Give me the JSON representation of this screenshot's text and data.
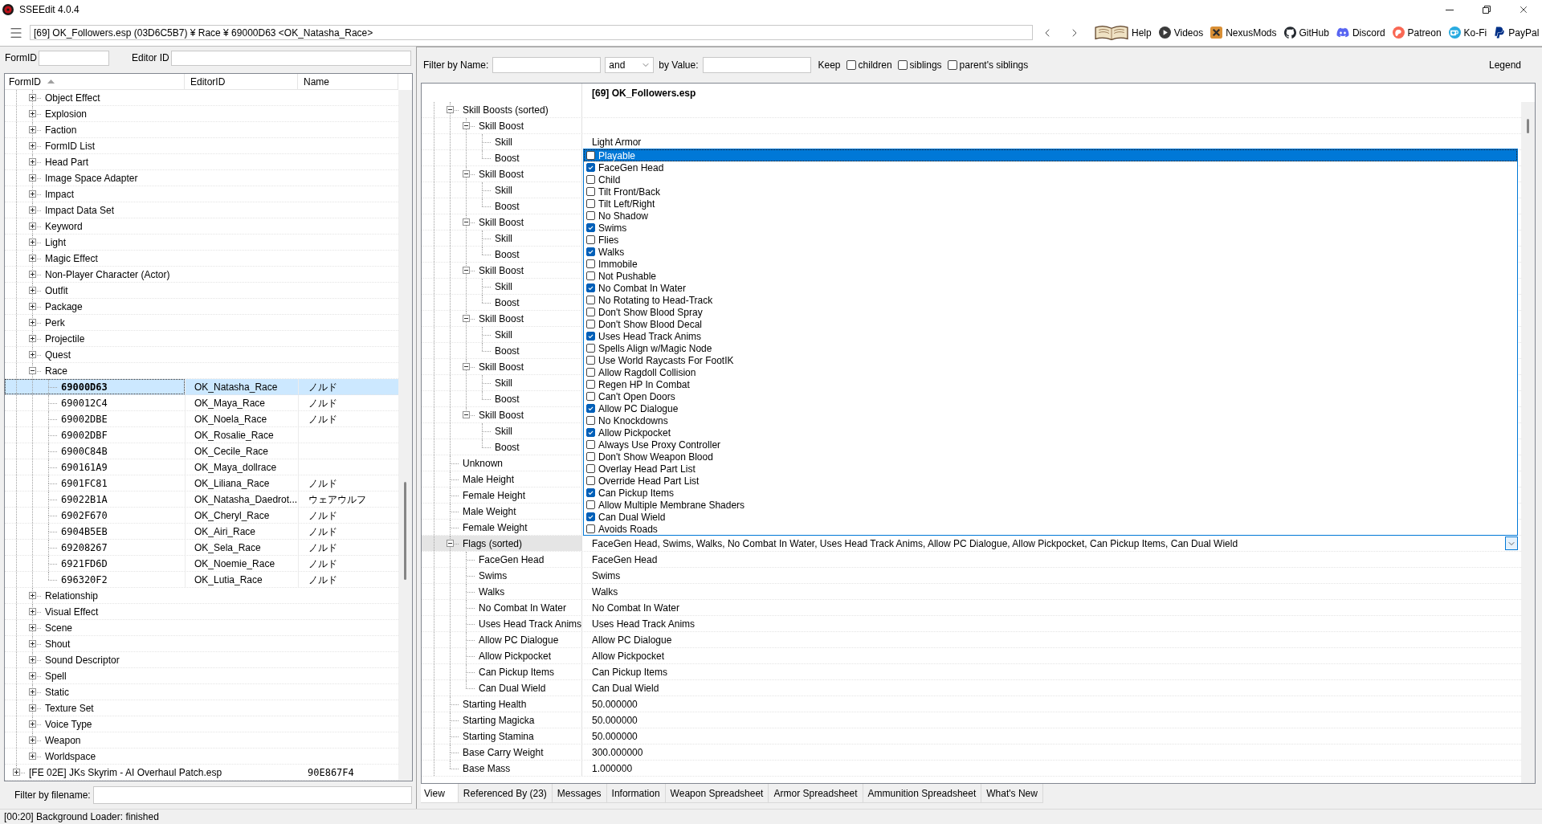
{
  "window": {
    "title": "SSEEdit 4.0.4"
  },
  "address_bar": {
    "path": "[69] OK_Followers.esp (03D6C5B7) ¥ Race ¥ 69000D63 <OK_Natasha_Race>"
  },
  "links": [
    {
      "label": "Help",
      "kind": "book"
    },
    {
      "label": "Videos",
      "kind": "videos"
    },
    {
      "label": "NexusMods",
      "kind": "nexus"
    },
    {
      "label": "GitHub",
      "kind": "github"
    },
    {
      "label": "Discord",
      "kind": "discord"
    },
    {
      "label": "Patreon",
      "kind": "patreon"
    },
    {
      "label": "Ko-Fi",
      "kind": "kofi"
    },
    {
      "label": "PayPal",
      "kind": "paypal"
    }
  ],
  "nav_filters": [
    {
      "label": "FormID"
    },
    {
      "label": "Editor ID"
    }
  ],
  "nav_tree": {
    "columns": [
      {
        "label": "FormID",
        "sorted": true
      },
      {
        "label": "EditorID",
        "sorted": false
      },
      {
        "label": "Name",
        "sorted": false
      }
    ],
    "nodes": [
      {
        "children": [
          {
            "label": "Object Effect",
            "expanded": false,
            "selected": false
          },
          {
            "label": "Explosion",
            "expanded": false,
            "selected": false
          },
          {
            "label": "Faction",
            "expanded": false,
            "selected": false
          },
          {
            "label": "FormID List",
            "expanded": false,
            "selected": false
          },
          {
            "label": "Head Part",
            "expanded": false,
            "selected": false
          },
          {
            "label": "Image Space Adapter",
            "expanded": false,
            "selected": false
          },
          {
            "label": "Impact",
            "expanded": false,
            "selected": false
          },
          {
            "label": "Impact Data Set",
            "expanded": false,
            "selected": false
          },
          {
            "label": "Keyword",
            "expanded": false,
            "selected": false
          },
          {
            "label": "Light",
            "expanded": false,
            "selected": false
          },
          {
            "label": "Magic Effect",
            "expanded": false,
            "selected": false
          },
          {
            "label": "Non-Player Character (Actor)",
            "expanded": false,
            "selected": false
          },
          {
            "label": "Outfit",
            "expanded": false,
            "selected": false
          },
          {
            "label": "Package",
            "expanded": false,
            "selected": false
          },
          {
            "label": "Perk",
            "expanded": false,
            "selected": false
          },
          {
            "label": "Projectile",
            "expanded": false,
            "selected": false
          },
          {
            "label": "Quest",
            "expanded": false,
            "selected": false
          },
          {
            "label": "Race",
            "expanded": true,
            "selected": false,
            "children": [
              {
                "form_id": "69000D63",
                "editor_id": "OK_Natasha_Race",
                "name": "ノルド",
                "selected": true
              },
              {
                "form_id": "690012C4",
                "editor_id": "OK_Maya_Race",
                "name": "ノルド",
                "selected": false
              },
              {
                "form_id": "69002DBE",
                "editor_id": "OK_Noela_Race",
                "name": "ノルド",
                "selected": false
              },
              {
                "form_id": "69002DBF",
                "editor_id": "OK_Rosalie_Race",
                "selected": false
              },
              {
                "form_id": "6900C84B",
                "editor_id": "OK_Cecile_Race",
                "selected": false
              },
              {
                "form_id": "690161A9",
                "editor_id": "OK_Maya_dollrace",
                "selected": false
              },
              {
                "form_id": "6901FC81",
                "editor_id": "OK_Liliana_Race",
                "name": "ノルド",
                "selected": false
              },
              {
                "form_id": "69022B1A",
                "editor_id": "OK_Natasha_Daedrot...",
                "name": "ウェアウルフ",
                "selected": false
              },
              {
                "form_id": "6902F670",
                "editor_id": "OK_Cheryl_Race",
                "name": "ノルド",
                "selected": false
              },
              {
                "form_id": "6904B5EB",
                "editor_id": "OK_Airi_Race",
                "name": "ノルド",
                "selected": false
              },
              {
                "form_id": "69208267",
                "editor_id": "OK_Sela_Race",
                "name": "ノルド",
                "selected": false
              },
              {
                "form_id": "6921FD6D",
                "editor_id": "OK_Noemie_Race",
                "name": "ノルド",
                "selected": false
              },
              {
                "form_id": "696320F2",
                "editor_id": "OK_Lutia_Race",
                "name": "ノルド",
                "selected": false
              }
            ]
          },
          {
            "label": "Relationship",
            "expanded": false,
            "selected": false
          },
          {
            "label": "Visual Effect",
            "expanded": false,
            "selected": false
          },
          {
            "label": "Scene",
            "expanded": false,
            "selected": false
          },
          {
            "label": "Shout",
            "expanded": false,
            "selected": false
          },
          {
            "label": "Sound Descriptor",
            "expanded": false,
            "selected": false
          },
          {
            "label": "Spell",
            "expanded": false,
            "selected": false
          },
          {
            "label": "Static",
            "expanded": false,
            "selected": false
          },
          {
            "label": "Texture Set",
            "expanded": false,
            "selected": false
          },
          {
            "label": "Voice Type",
            "expanded": false,
            "selected": false
          },
          {
            "label": "Weapon",
            "expanded": false,
            "selected": false
          },
          {
            "label": "Worldspace",
            "expanded": false,
            "selected": false
          }
        ]
      },
      {
        "label": "[FE 02E] JKs Skyrim - AI Overhaul Patch.esp",
        "name": "90E867F4",
        "expanded": false,
        "selected": false
      }
    ]
  },
  "filename_filter": {
    "label": "Filter by filename:"
  },
  "record_filter": {
    "name_label": "Filter by Name:",
    "operator": "and",
    "value_label": "by Value:",
    "keep_label": "Keep",
    "keep_options": [
      {
        "label": "children",
        "checked": false
      },
      {
        "label": "siblings",
        "checked": false
      },
      {
        "label": "parent's siblings",
        "checked": false
      }
    ],
    "legend": "Legend"
  },
  "record_view": {
    "header": "[69] OK_Followers.esp",
    "rows": [
      {
        "label": "Skill Boosts (sorted)",
        "expanded": true,
        "selected": false,
        "children": [
          {
            "label": "Skill Boost",
            "expanded": true,
            "selected": false,
            "children": [
              {
                "label": "Skill",
                "value": "Light Armor",
                "selected": false
              },
              {
                "label": "Boost",
                "selected": false
              }
            ]
          },
          {
            "label": "Skill Boost",
            "expanded": true,
            "selected": false,
            "children": [
              {
                "label": "Skill",
                "selected": false
              },
              {
                "label": "Boost",
                "selected": false
              }
            ]
          },
          {
            "label": "Skill Boost",
            "expanded": true,
            "selected": false,
            "children": [
              {
                "label": "Skill",
                "selected": false
              },
              {
                "label": "Boost",
                "selected": false
              }
            ]
          },
          {
            "label": "Skill Boost",
            "expanded": true,
            "selected": false,
            "children": [
              {
                "label": "Skill",
                "selected": false
              },
              {
                "label": "Boost",
                "selected": false
              }
            ]
          },
          {
            "label": "Skill Boost",
            "expanded": true,
            "selected": false,
            "children": [
              {
                "label": "Skill",
                "selected": false
              },
              {
                "label": "Boost",
                "selected": false
              }
            ]
          },
          {
            "label": "Skill Boost",
            "expanded": true,
            "selected": false,
            "children": [
              {
                "label": "Skill",
                "selected": false
              },
              {
                "label": "Boost",
                "selected": false
              }
            ]
          },
          {
            "label": "Skill Boost",
            "expanded": true,
            "selected": false,
            "children": [
              {
                "label": "Skill",
                "selected": false
              },
              {
                "label": "Boost",
                "selected": false
              }
            ]
          }
        ]
      },
      {
        "label": "Unknown",
        "selected": false
      },
      {
        "label": "Male Height",
        "selected": false
      },
      {
        "label": "Female Height",
        "selected": false
      },
      {
        "label": "Male Weight",
        "selected": false
      },
      {
        "label": "Female Weight",
        "selected": false
      },
      {
        "label": "Flags (sorted)",
        "expanded": true,
        "selected": true,
        "value": "FaceGen Head, Swims, Walks, No Combat In Water, Uses Head Track Anims, Allow PC Dialogue, Allow Pickpocket, Can Pickup Items, Can Dual Wield",
        "editor": {
          "open": true,
          "options": [
            {
              "label": "Playable",
              "checked": false,
              "selected": true
            },
            {
              "label": "FaceGen Head",
              "checked": true,
              "selected": false
            },
            {
              "label": "Child",
              "checked": false,
              "selected": false
            },
            {
              "label": "Tilt Front/Back",
              "checked": false,
              "selected": false
            },
            {
              "label": "Tilt Left/Right",
              "checked": false,
              "selected": false
            },
            {
              "label": "No Shadow",
              "checked": false,
              "selected": false
            },
            {
              "label": "Swims",
              "checked": true,
              "selected": false
            },
            {
              "label": "Flies",
              "checked": false,
              "selected": false
            },
            {
              "label": "Walks",
              "checked": true,
              "selected": false
            },
            {
              "label": "Immobile",
              "checked": false,
              "selected": false
            },
            {
              "label": "Not Pushable",
              "checked": false,
              "selected": false
            },
            {
              "label": "No Combat In Water",
              "checked": true,
              "selected": false
            },
            {
              "label": "No Rotating to Head-Track",
              "checked": false,
              "selected": false
            },
            {
              "label": "Don't Show Blood Spray",
              "checked": false,
              "selected": false
            },
            {
              "label": "Don't Show Blood Decal",
              "checked": false,
              "selected": false
            },
            {
              "label": "Uses Head Track Anims",
              "checked": true,
              "selected": false
            },
            {
              "label": "Spells Align w/Magic Node",
              "checked": false,
              "selected": false
            },
            {
              "label": "Use World Raycasts For FootIK",
              "checked": false,
              "selected": false
            },
            {
              "label": "Allow Ragdoll Collision",
              "checked": false,
              "selected": false
            },
            {
              "label": "Regen HP In Combat",
              "checked": false,
              "selected": false
            },
            {
              "label": "Can't Open Doors",
              "checked": false,
              "selected": false
            },
            {
              "label": "Allow PC Dialogue",
              "checked": true,
              "selected": false
            },
            {
              "label": "No Knockdowns",
              "checked": false,
              "selected": false
            },
            {
              "label": "Allow Pickpocket",
              "checked": true,
              "selected": false
            },
            {
              "label": "Always Use Proxy Controller",
              "checked": false,
              "selected": false
            },
            {
              "label": "Don't Show Weapon Blood",
              "checked": false,
              "selected": false
            },
            {
              "label": "Overlay Head Part List",
              "checked": false,
              "selected": false
            },
            {
              "label": "Override Head Part List",
              "checked": false,
              "selected": false
            },
            {
              "label": "Can Pickup Items",
              "checked": true,
              "selected": false
            },
            {
              "label": "Allow Multiple Membrane Shaders",
              "checked": false,
              "selected": false
            },
            {
              "label": "Can Dual Wield",
              "checked": true,
              "selected": false
            },
            {
              "label": "Avoids Roads",
              "checked": false,
              "selected": false
            }
          ]
        },
        "children": [
          {
            "label": "FaceGen Head",
            "value": "FaceGen Head",
            "selected": false
          },
          {
            "label": "Swims",
            "value": "Swims",
            "selected": false
          },
          {
            "label": "Walks",
            "value": "Walks",
            "selected": false
          },
          {
            "label": "No Combat In Water",
            "value": "No Combat In Water",
            "selected": false
          },
          {
            "label": "Uses Head Track Anims",
            "value": "Uses Head Track Anims",
            "selected": false
          },
          {
            "label": "Allow PC Dialogue",
            "value": "Allow PC Dialogue",
            "selected": false
          },
          {
            "label": "Allow Pickpocket",
            "value": "Allow Pickpocket",
            "selected": false
          },
          {
            "label": "Can Pickup Items",
            "value": "Can Pickup Items",
            "selected": false
          },
          {
            "label": "Can Dual Wield",
            "value": "Can Dual Wield",
            "selected": false
          }
        ]
      },
      {
        "label": "Starting Health",
        "value": "50.000000",
        "selected": false
      },
      {
        "label": "Starting Magicka",
        "value": "50.000000",
        "selected": false
      },
      {
        "label": "Starting Stamina",
        "value": "50.000000",
        "selected": false
      },
      {
        "label": "Base Carry Weight",
        "value": "300.000000",
        "selected": false
      },
      {
        "label": "Base Mass",
        "value": "1.000000",
        "selected": false
      }
    ]
  },
  "tabs": [
    {
      "label": "View",
      "selected": true
    },
    {
      "label": "Referenced By (23)",
      "selected": false
    },
    {
      "label": "Messages",
      "selected": false
    },
    {
      "label": "Information",
      "selected": false
    },
    {
      "label": "Weapon Spreadsheet",
      "selected": false
    },
    {
      "label": "Armor Spreadsheet",
      "selected": false
    },
    {
      "label": "Ammunition Spreadsheet",
      "selected": false
    },
    {
      "label": "What's New",
      "selected": false
    }
  ],
  "status_bar": {
    "text": "[00:20] Background Loader: finished"
  }
}
